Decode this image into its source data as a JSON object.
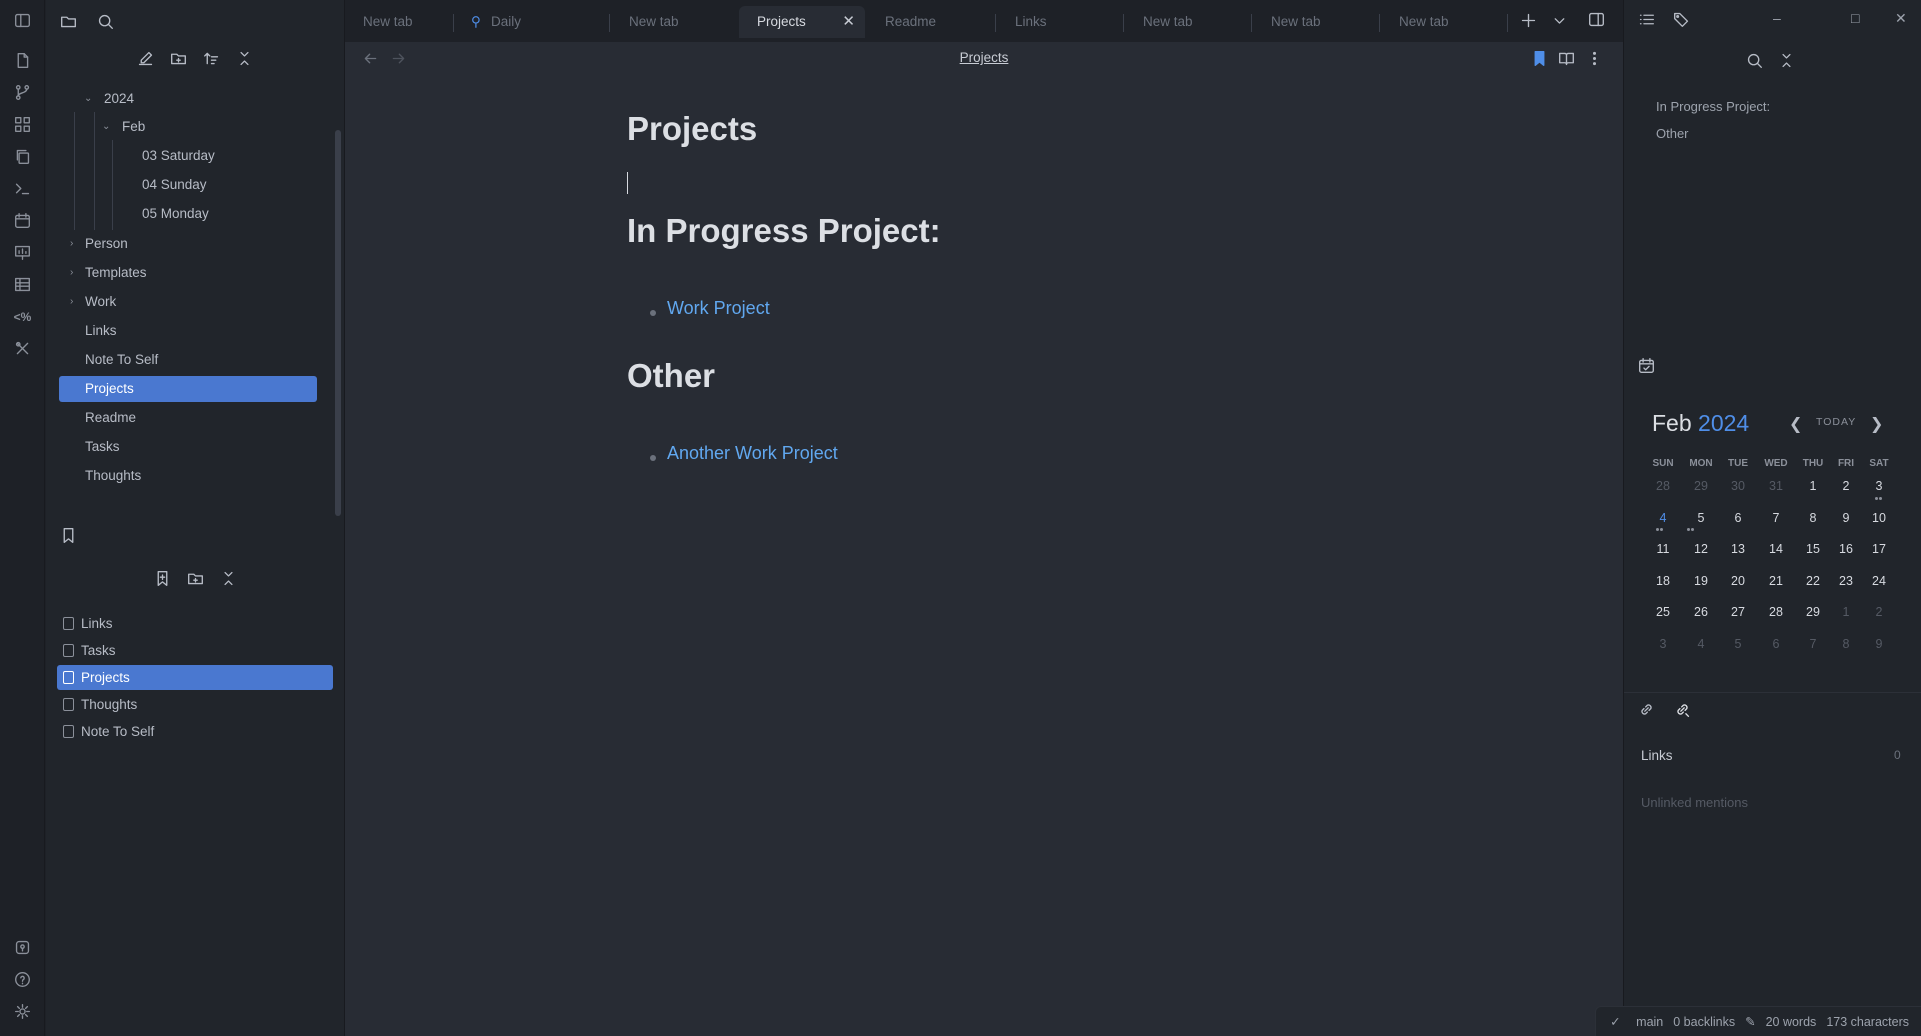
{
  "tabs": [
    {
      "label": "New tab"
    },
    {
      "label": "Daily"
    },
    {
      "label": "New tab"
    },
    {
      "label": "Projects"
    },
    {
      "label": "Readme"
    },
    {
      "label": "Links"
    },
    {
      "label": "New tab"
    },
    {
      "label": "New tab"
    },
    {
      "label": "New tab"
    }
  ],
  "tree": {
    "year": "2024",
    "month": "Feb",
    "days": [
      "03 Saturday",
      "04 Sunday",
      "05 Monday"
    ],
    "folders": [
      "Person",
      "Templates",
      "Work"
    ],
    "files": [
      "Links",
      "Note To Self",
      "Projects",
      "Readme",
      "Tasks",
      "Thoughts"
    ]
  },
  "bookmarks": [
    "Links",
    "Tasks",
    "Projects",
    "Thoughts",
    "Note To Self"
  ],
  "editor": {
    "header_title": "Projects",
    "title": "Projects",
    "h_in_progress": "In Progress Project:",
    "link_work": "Work Project",
    "h_other": "Other",
    "link_another": "Another Work Project"
  },
  "outline": [
    "In Progress Project:",
    "Other"
  ],
  "calendar": {
    "month": "Feb",
    "year": "2024",
    "today_label": "TODAY",
    "dow": [
      "SUN",
      "MON",
      "TUE",
      "WED",
      "THU",
      "FRI",
      "SAT"
    ],
    "weeks": [
      [
        "28",
        "29",
        "30",
        "31",
        "1",
        "2",
        "3"
      ],
      [
        "4",
        "5",
        "6",
        "7",
        "8",
        "9",
        "10"
      ],
      [
        "11",
        "12",
        "13",
        "14",
        "15",
        "16",
        "17"
      ],
      [
        "18",
        "19",
        "20",
        "21",
        "22",
        "23",
        "24"
      ],
      [
        "25",
        "26",
        "27",
        "28",
        "29",
        "1",
        "2"
      ],
      [
        "3",
        "4",
        "5",
        "6",
        "7",
        "8",
        "9"
      ]
    ]
  },
  "backlinks": {
    "links_label": "Links",
    "links_count": "0",
    "unlinked_label": "Unlinked mentions"
  },
  "status": {
    "branch": "main",
    "backlinks": "0 backlinks",
    "words": "20 words",
    "characters": "173 characters"
  },
  "colors": {
    "accent": "#4a78d0",
    "link": "#61a8f0",
    "calendar_year": "#4f8ee8"
  }
}
